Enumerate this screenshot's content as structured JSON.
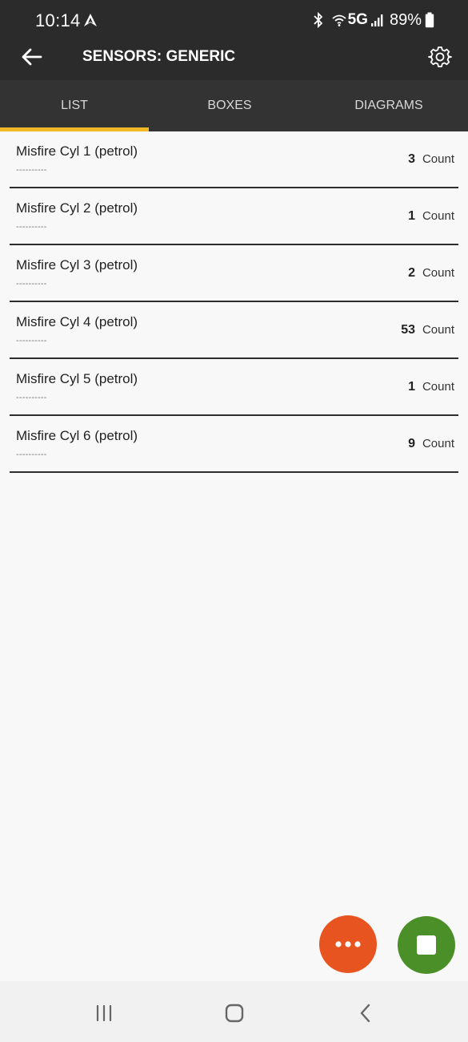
{
  "status_bar": {
    "time": "10:14",
    "network": "5G",
    "battery": "89%"
  },
  "app_bar": {
    "title": "SENSORS: GENERIC"
  },
  "tabs": [
    {
      "label": "LIST",
      "selected": true
    },
    {
      "label": "BOXES",
      "selected": false
    },
    {
      "label": "DIAGRAMS",
      "selected": false
    }
  ],
  "sensors": [
    {
      "name": "Misfire Cyl 1 (petrol)",
      "placeholder": "----------",
      "value": "3",
      "unit": "Count"
    },
    {
      "name": "Misfire Cyl 2 (petrol)",
      "placeholder": "----------",
      "value": "1",
      "unit": "Count"
    },
    {
      "name": "Misfire Cyl 3 (petrol)",
      "placeholder": "----------",
      "value": "2",
      "unit": "Count"
    },
    {
      "name": "Misfire Cyl 4 (petrol)",
      "placeholder": "----------",
      "value": "53",
      "unit": "Count"
    },
    {
      "name": "Misfire Cyl 5 (petrol)",
      "placeholder": "----------",
      "value": "1",
      "unit": "Count"
    },
    {
      "name": "Misfire Cyl 6 (petrol)",
      "placeholder": "----------",
      "value": "9",
      "unit": "Count"
    }
  ],
  "colors": {
    "header_bg": "#2b2b2b",
    "tab_bg": "#333333",
    "tab_indicator": "#f2b724",
    "fab_more": "#e8541f",
    "fab_stop": "#4a8f28"
  },
  "icons": {
    "back": "arrow-left-icon",
    "settings": "gear-icon",
    "more": "more-horizontal-icon",
    "stop": "stop-icon",
    "recents": "recents-icon",
    "home": "home-icon",
    "system_back": "chevron-left-icon"
  }
}
